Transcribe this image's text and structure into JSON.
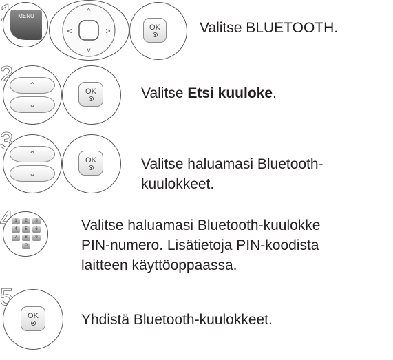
{
  "steps": [
    {
      "number": "1",
      "text": "Valitse BLUETOOTH."
    },
    {
      "number": "2",
      "text_prefix": "Valitse ",
      "text_bold": "Etsi kuuloke",
      "text_suffix": "."
    },
    {
      "number": "3",
      "lines": [
        "Valitse haluamasi Bluetooth-",
        "kuulokkeet."
      ]
    },
    {
      "number": "4",
      "lines": [
        "Valitse haluamasi Bluetooth-kuulokke",
        "PIN-numero. Lisätietoja PIN-koodista",
        "laitteen käyttöoppaassa."
      ]
    },
    {
      "number": "5",
      "text": "Yhdistä Bluetooth-kuulokkeet."
    }
  ],
  "buttons": {
    "menu_label": "MENU",
    "ok_label": "OK",
    "up_symbol": "⌃",
    "down_symbol": "⌄",
    "nav_up": "^",
    "nav_down": "v",
    "nav_left": "<",
    "nav_right": ">",
    "keys": [
      "1",
      "2",
      "3",
      "4",
      "5",
      "6",
      "7",
      "8",
      "9",
      "0"
    ]
  }
}
